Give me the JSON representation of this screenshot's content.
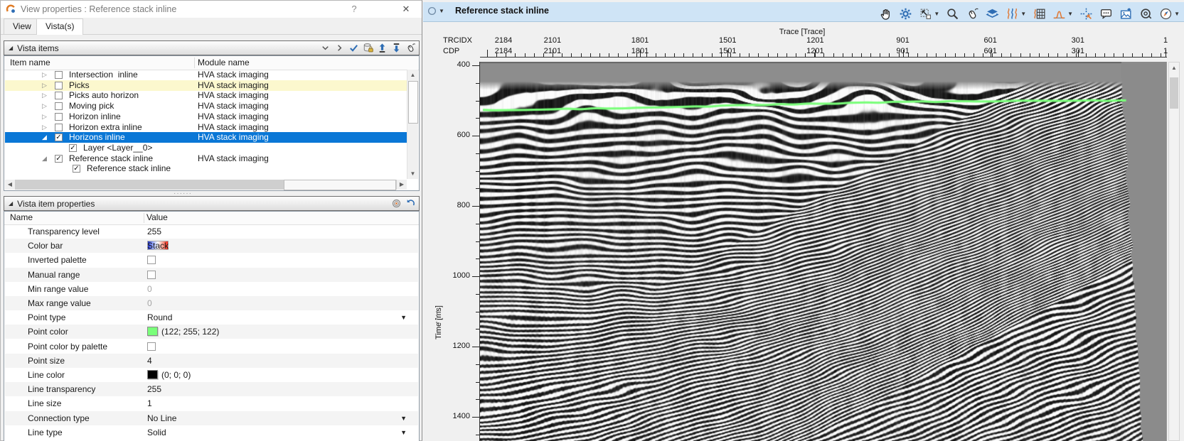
{
  "dialog": {
    "title": "View properties : Reference stack inline",
    "help_label": "?",
    "close_label": "✕",
    "tabs": [
      "View",
      "Vista(s)"
    ],
    "vista_items": {
      "header": "Vista items",
      "columns": [
        "Item name",
        "Module name"
      ],
      "toolbar_icons": [
        "chevron-down",
        "chevron-right",
        "apply-check",
        "database-lock",
        "move-up",
        "move-down",
        "mouse-mode"
      ],
      "rows": [
        {
          "name": "Intersection  inline",
          "module": "HVA stack imaging",
          "state": "collapsed",
          "checked": false,
          "highlight": "none"
        },
        {
          "name": "Picks",
          "module": "HVA stack imaging",
          "state": "collapsed",
          "checked": false,
          "highlight": "yellow"
        },
        {
          "name": "Picks auto horizon",
          "module": "HVA stack imaging",
          "state": "collapsed",
          "checked": false,
          "highlight": "none"
        },
        {
          "name": "Moving pick",
          "module": "HVA stack imaging",
          "state": "collapsed",
          "checked": false,
          "highlight": "none"
        },
        {
          "name": "Horizon inline",
          "module": "HVA stack imaging",
          "state": "collapsed",
          "checked": false,
          "highlight": "none"
        },
        {
          "name": "Horizon extra inline",
          "module": "HVA stack imaging",
          "state": "collapsed",
          "checked": false,
          "highlight": "none"
        },
        {
          "name": "Horizons inline",
          "module": "HVA stack imaging",
          "state": "expanded",
          "checked": true,
          "highlight": "selected"
        },
        {
          "name": "Layer <Layer__0>",
          "module": "",
          "state": "child",
          "checked": true,
          "highlight": "none"
        },
        {
          "name": "Reference stack inline",
          "module": "HVA stack imaging",
          "state": "expanded",
          "checked": true,
          "highlight": "none"
        },
        {
          "name": "Reference stack inline",
          "module": "",
          "state": "child2",
          "checked": true,
          "highlight": "none"
        }
      ]
    },
    "properties": {
      "header": "Vista item properties",
      "toolbar_icons": [
        "target",
        "undo"
      ],
      "columns": [
        "Name",
        "Value"
      ],
      "rows": [
        {
          "name": "Transparency level",
          "type": "text",
          "value": "255"
        },
        {
          "name": "Color bar",
          "type": "colorbar",
          "value": "Stack"
        },
        {
          "name": "Inverted palette",
          "type": "checkbox",
          "checked": false
        },
        {
          "name": "Manual range",
          "type": "checkbox",
          "checked": false
        },
        {
          "name": "Min range value",
          "type": "text-dim",
          "value": "0"
        },
        {
          "name": "Max range value",
          "type": "text-dim",
          "value": "0"
        },
        {
          "name": "Point type",
          "type": "dropdown",
          "value": "Round"
        },
        {
          "name": "Point color",
          "type": "swatch",
          "swatch": "#7aff7a",
          "value": "(122; 255; 122)"
        },
        {
          "name": "Point color by palette",
          "type": "checkbox",
          "checked": false
        },
        {
          "name": "Point size",
          "type": "text",
          "value": "4"
        },
        {
          "name": "Line color",
          "type": "swatch",
          "swatch": "#000000",
          "value": "(0; 0; 0)"
        },
        {
          "name": "Line transparency",
          "type": "text",
          "value": "255"
        },
        {
          "name": "Line size",
          "type": "text",
          "value": "1"
        },
        {
          "name": "Connection type",
          "type": "dropdown",
          "value": "No Line"
        },
        {
          "name": "Line type",
          "type": "dropdown",
          "value": "Solid"
        }
      ]
    }
  },
  "viewer": {
    "title": "Reference stack inline",
    "toolbar": [
      {
        "icon": "pan-hand",
        "caret": false
      },
      {
        "icon": "gear",
        "caret": false
      },
      {
        "icon": "fit-view",
        "caret": true
      },
      {
        "icon": "magnifier",
        "caret": false
      },
      {
        "icon": "mouse-mode",
        "caret": false
      },
      {
        "icon": "layers",
        "caret": false
      },
      {
        "icon": "wiggle-display",
        "caret": true
      },
      {
        "icon": "grid-wiggle",
        "caret": false
      },
      {
        "icon": "histogram",
        "caret": true
      },
      {
        "icon": "crosshair-pick",
        "caret": false
      },
      {
        "icon": "comment",
        "caret": false
      },
      {
        "icon": "image-export",
        "caret": false
      },
      {
        "icon": "record",
        "caret": false
      },
      {
        "icon": "compass",
        "caret": true
      }
    ],
    "axes": {
      "trace_title": "Trace [Trace]",
      "row_labels": [
        "TRCIDX",
        "CDP"
      ],
      "trace_ticks": [
        2101,
        1801,
        1501,
        1201,
        901,
        601,
        301,
        1
      ],
      "trace_edge_label": "2184",
      "time_label": "Time [ms]",
      "time_ticks": [
        400,
        600,
        800,
        1000,
        1200,
        1400
      ]
    },
    "colors": {
      "horizon_green": "#7aff7a",
      "selection_blue": "#0a77d6",
      "header_blue": "#cfe4f6",
      "row_yellow": "#fcf8ce"
    }
  }
}
